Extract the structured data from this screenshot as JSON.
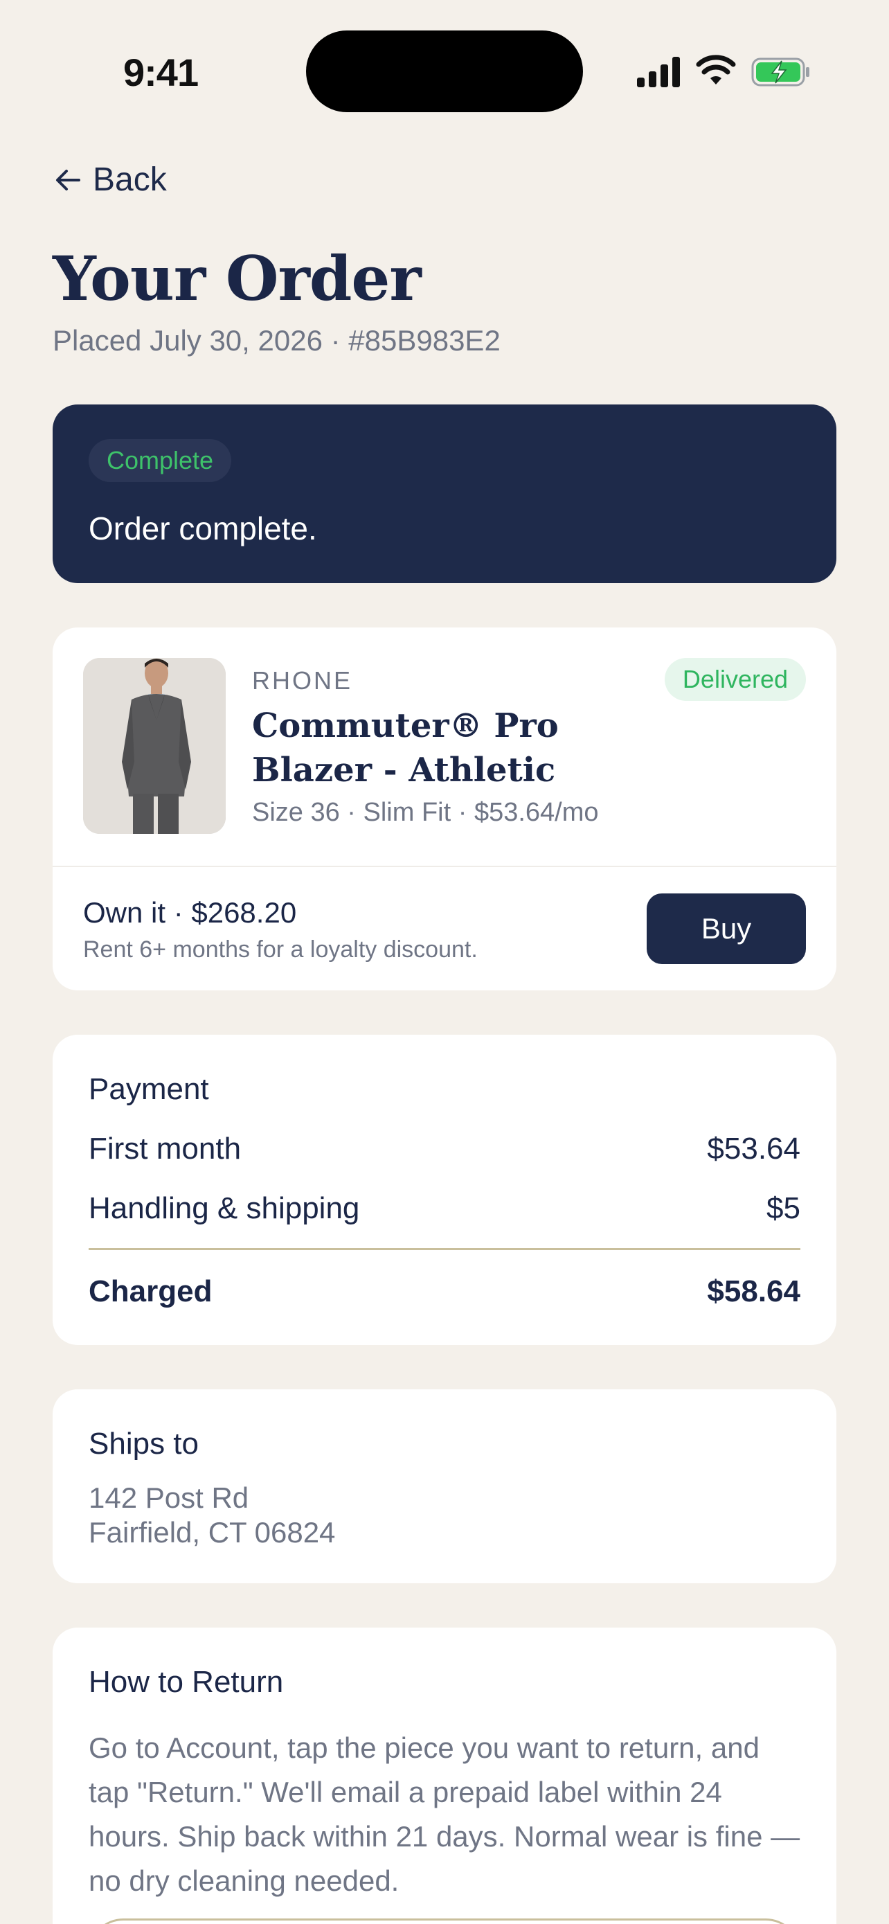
{
  "status_bar": {
    "time": "9:41",
    "icons": [
      "signal-icon",
      "wifi-icon",
      "battery-charging-icon"
    ],
    "battery_color": "#34c759"
  },
  "nav": {
    "back_label": "Back",
    "back_icon": "arrow-left-icon"
  },
  "header": {
    "title": "Your Order",
    "subtitle": "Placed July 30, 2026 · #85B983E2"
  },
  "banner": {
    "status_chip": "Complete",
    "message": "Order complete.",
    "background": "#1e2a4a",
    "chip_color": "#3ec26a"
  },
  "product": {
    "brand": "RHONE",
    "status": "Delivered",
    "name": "Commuter® Pro Blazer - Athletic",
    "meta": "Size 36 · Slim Fit · $53.64/mo",
    "own_title": "Own it · $268.20",
    "own_subtitle": "Rent 6+ months for a loyalty discount.",
    "buy_label": "Buy"
  },
  "payment": {
    "heading": "Payment",
    "rows": [
      {
        "label": "First month",
        "value": "$53.64"
      },
      {
        "label": "Handling & shipping",
        "value": "$5"
      }
    ],
    "total_label": "Charged",
    "total_value": "$58.64"
  },
  "shipping": {
    "heading": "Ships to",
    "line1": "142 Post Rd",
    "line2": "Fairfield, CT 06824"
  },
  "returns": {
    "heading": "How to Return",
    "body": "Go to Account, tap the piece you want to return, and tap \"Return.\" We'll email a prepaid label within 24 hours. Ship back within 21 days. Normal wear is fine — no dry cleaning needed."
  }
}
